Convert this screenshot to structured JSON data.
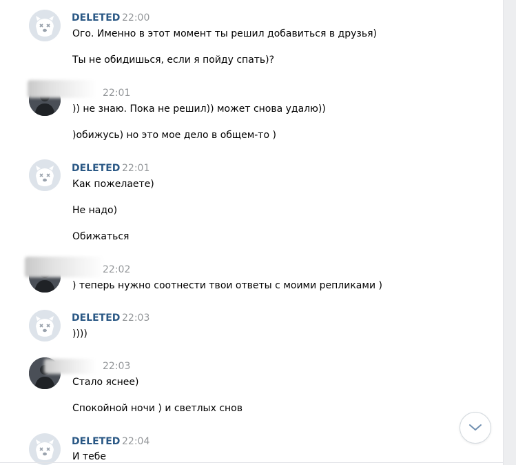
{
  "chat": {
    "messages": [
      {
        "author": "DELETED",
        "time": "22:00",
        "avatar": "deleted",
        "lines": [
          "Ого. Именно в этот момент ты решил добавиться в друзья)",
          "Ты не обидишься, если я пойду спать)?"
        ]
      },
      {
        "author": "",
        "time": "22:01",
        "avatar": "user",
        "lines": [
          ")) не знаю. Пока не решил)) может снова удалю))",
          ")обижусь) но это мое дело в общем-то )"
        ]
      },
      {
        "author": "DELETED",
        "time": "22:01",
        "avatar": "deleted",
        "lines": [
          "Как пожелаете)",
          "Не надо)",
          "Обижаться"
        ]
      },
      {
        "author": "",
        "time": "22:02",
        "avatar": "user",
        "lines": [
          ") теперь нужно соотнести твои ответы с моими репликами )"
        ]
      },
      {
        "author": "DELETED",
        "time": "22:03",
        "avatar": "deleted",
        "lines": [
          "))))"
        ]
      },
      {
        "author": "",
        "time": "22:03",
        "avatar": "user",
        "lines": [
          "Стало яснее)",
          "Спокойной ночи ) и светлых снов"
        ]
      },
      {
        "author": "DELETED",
        "time": "22:04",
        "avatar": "deleted",
        "lines": [
          "И тебе"
        ]
      }
    ]
  },
  "icons": {
    "deleted_avatar": "deleted-dog-avatar-icon",
    "scroll_down": "chevron-down-icon"
  },
  "colors": {
    "author_link": "#2a5885",
    "time": "#939699",
    "avatar_bg": "#dde3ea",
    "page_bg": "#edeef0"
  }
}
